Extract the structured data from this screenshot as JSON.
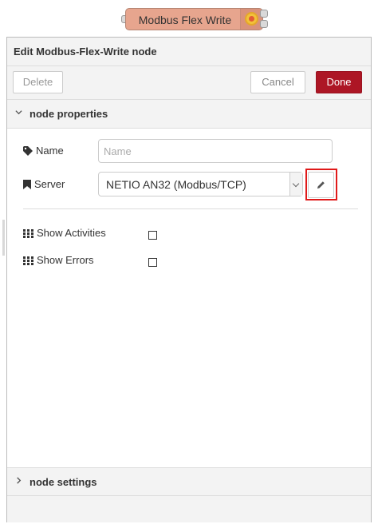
{
  "flow_node": {
    "label": "Modbus Flex Write",
    "icon": "modbus-icon"
  },
  "tray": {
    "title": "Edit Modbus-Flex-Write node",
    "buttons": {
      "delete": "Delete",
      "cancel": "Cancel",
      "done": "Done"
    }
  },
  "sections": {
    "properties": {
      "label": "node properties",
      "icon": "chevron-down-icon"
    },
    "settings": {
      "label": "node settings",
      "icon": "chevron-right-icon"
    }
  },
  "form": {
    "name": {
      "label": "Name",
      "icon": "tag-icon",
      "value": "",
      "placeholder": "Name"
    },
    "server": {
      "label": "Server",
      "icon": "bookmark-icon",
      "value": "NETIO AN32 (Modbus/TCP)",
      "edit_icon": "pencil-icon"
    },
    "show_activities": {
      "label": "Show Activities",
      "icon": "grid-icon",
      "checked": false
    },
    "show_errors": {
      "label": "Show Errors",
      "icon": "grid-icon",
      "checked": false
    }
  },
  "colors": {
    "done_button": "#ad1625",
    "node_fill": "#e7a58e",
    "highlight": "#e01919"
  }
}
